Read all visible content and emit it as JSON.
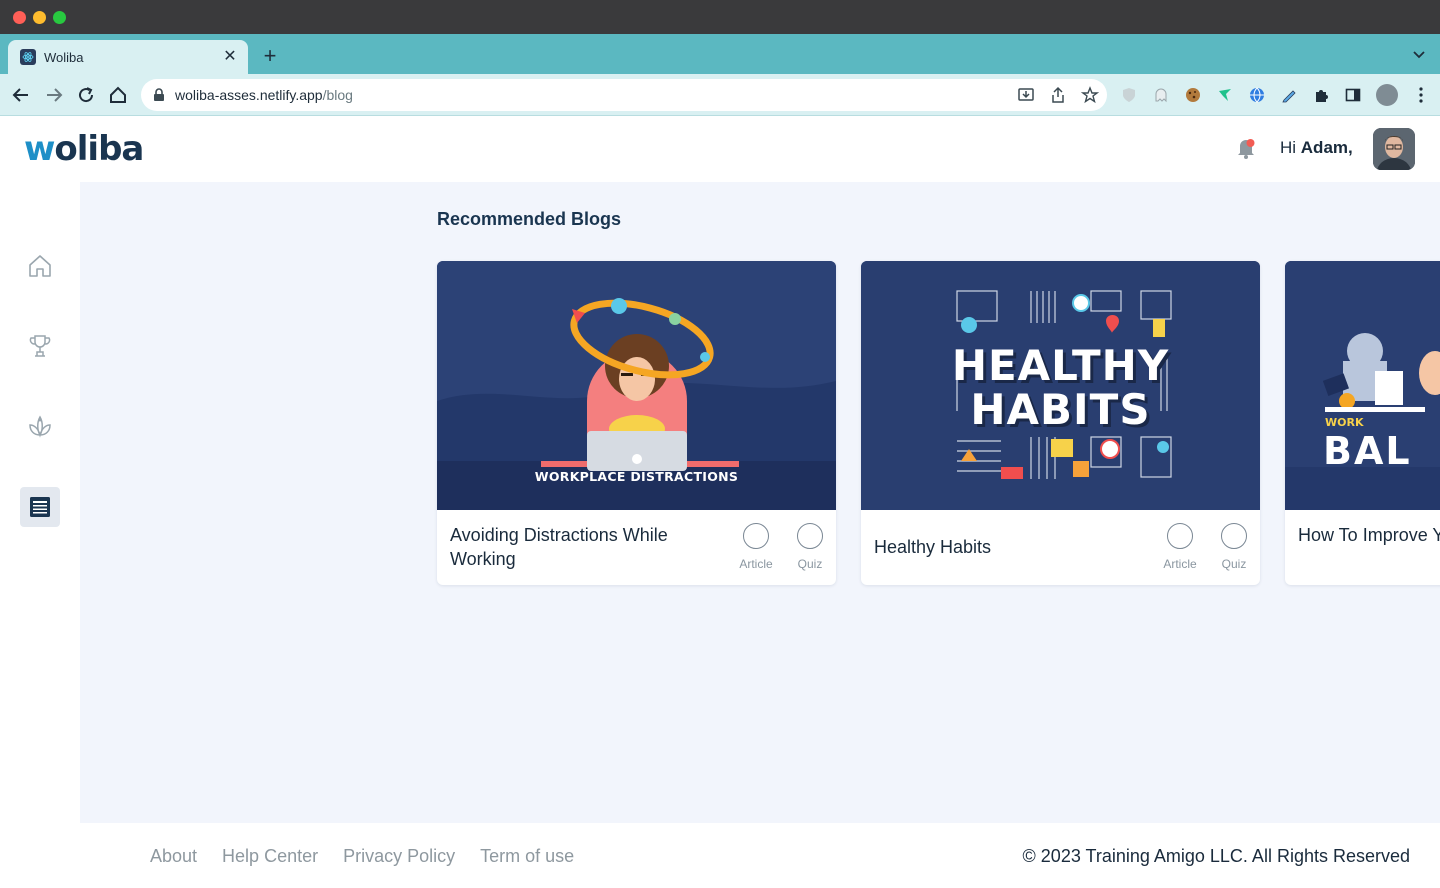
{
  "browser": {
    "tab_title": "Woliba",
    "url_host": "woliba-asses.netlify.app",
    "url_path": "/blog"
  },
  "header": {
    "logo_text": "woliba",
    "greeting_prefix": "Hi ",
    "user_name": "Adam,"
  },
  "sidebar": {
    "items": [
      {
        "icon": "home-icon",
        "active": false
      },
      {
        "icon": "trophy-icon",
        "active": false
      },
      {
        "icon": "lotus-icon",
        "active": false
      },
      {
        "icon": "blog-icon",
        "active": true
      }
    ]
  },
  "main": {
    "section_title": "Recommended Blogs",
    "cards": [
      {
        "title": "Avoiding Distractions While Working",
        "image_caption": "WORKPLACE DISTRACTIONS",
        "article_label": "Article",
        "quiz_label": "Quiz"
      },
      {
        "title": "Healthy Habits",
        "image_line1": "HEALTHY",
        "image_line2": "HABITS",
        "article_label": "Article",
        "quiz_label": "Quiz"
      },
      {
        "title": "How To Improve Your Work-Life Balance",
        "image_small": "WORK",
        "image_big": "BAL"
      }
    ]
  },
  "footer": {
    "links": [
      "About",
      "Help Center",
      "Privacy Policy",
      "Term of use"
    ],
    "copyright": "© 2023 Training Amigo LLC. All Rights Reserved"
  },
  "colors": {
    "brand_navy": "#1a3550",
    "brand_blue": "#1e8fc7",
    "card_image_bg": "#2c4276",
    "main_bg": "#f2f5fc",
    "browser_tab_strip": "#5bb8c1"
  }
}
